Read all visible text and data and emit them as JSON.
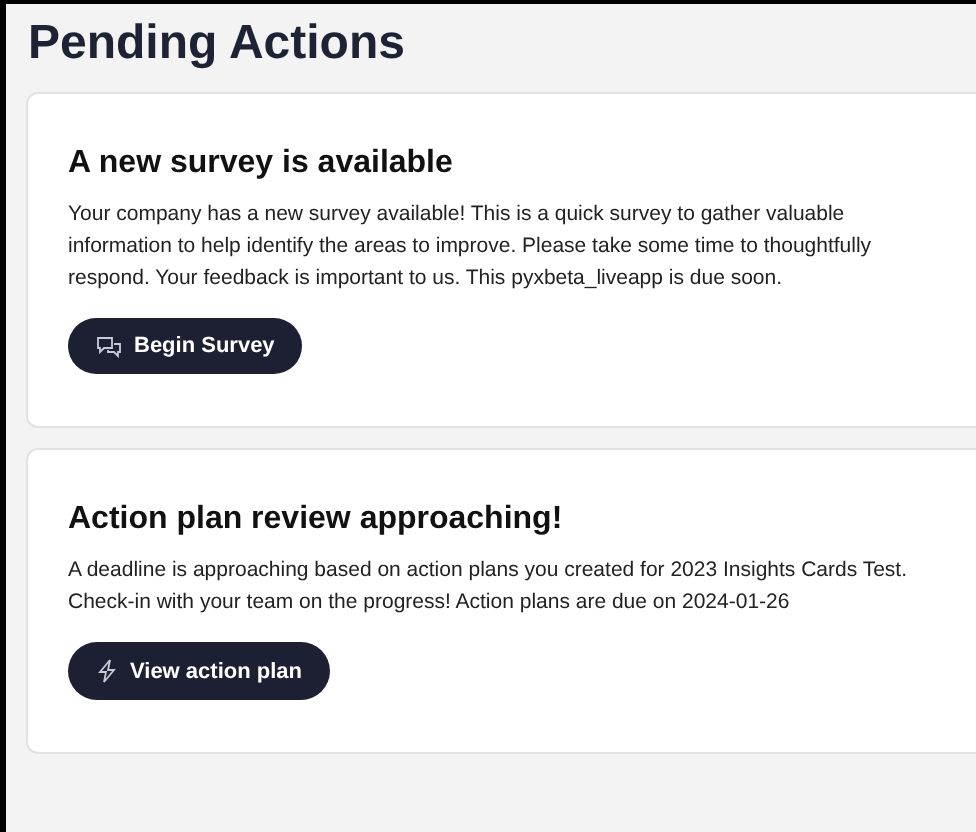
{
  "page": {
    "title": "Pending Actions"
  },
  "cards": [
    {
      "heading": "A new survey is available",
      "body": "Your company has a new survey available! This is a quick survey to gather valuable information to help identify the areas to improve. Please take some time to thoughtfully respond. Your feedback is important to us. This pyxbeta_liveapp is due soon.",
      "button": {
        "label": "Begin Survey",
        "kind": "chat"
      }
    },
    {
      "heading": "Action plan review approaching!",
      "body": "A deadline is approaching based on action plans you created for 2023 Insights Cards Test. Check-in with your team on the progress! Action plans are due on 2024-01-26",
      "button": {
        "label": "View action plan",
        "kind": "bolt"
      }
    }
  ]
}
